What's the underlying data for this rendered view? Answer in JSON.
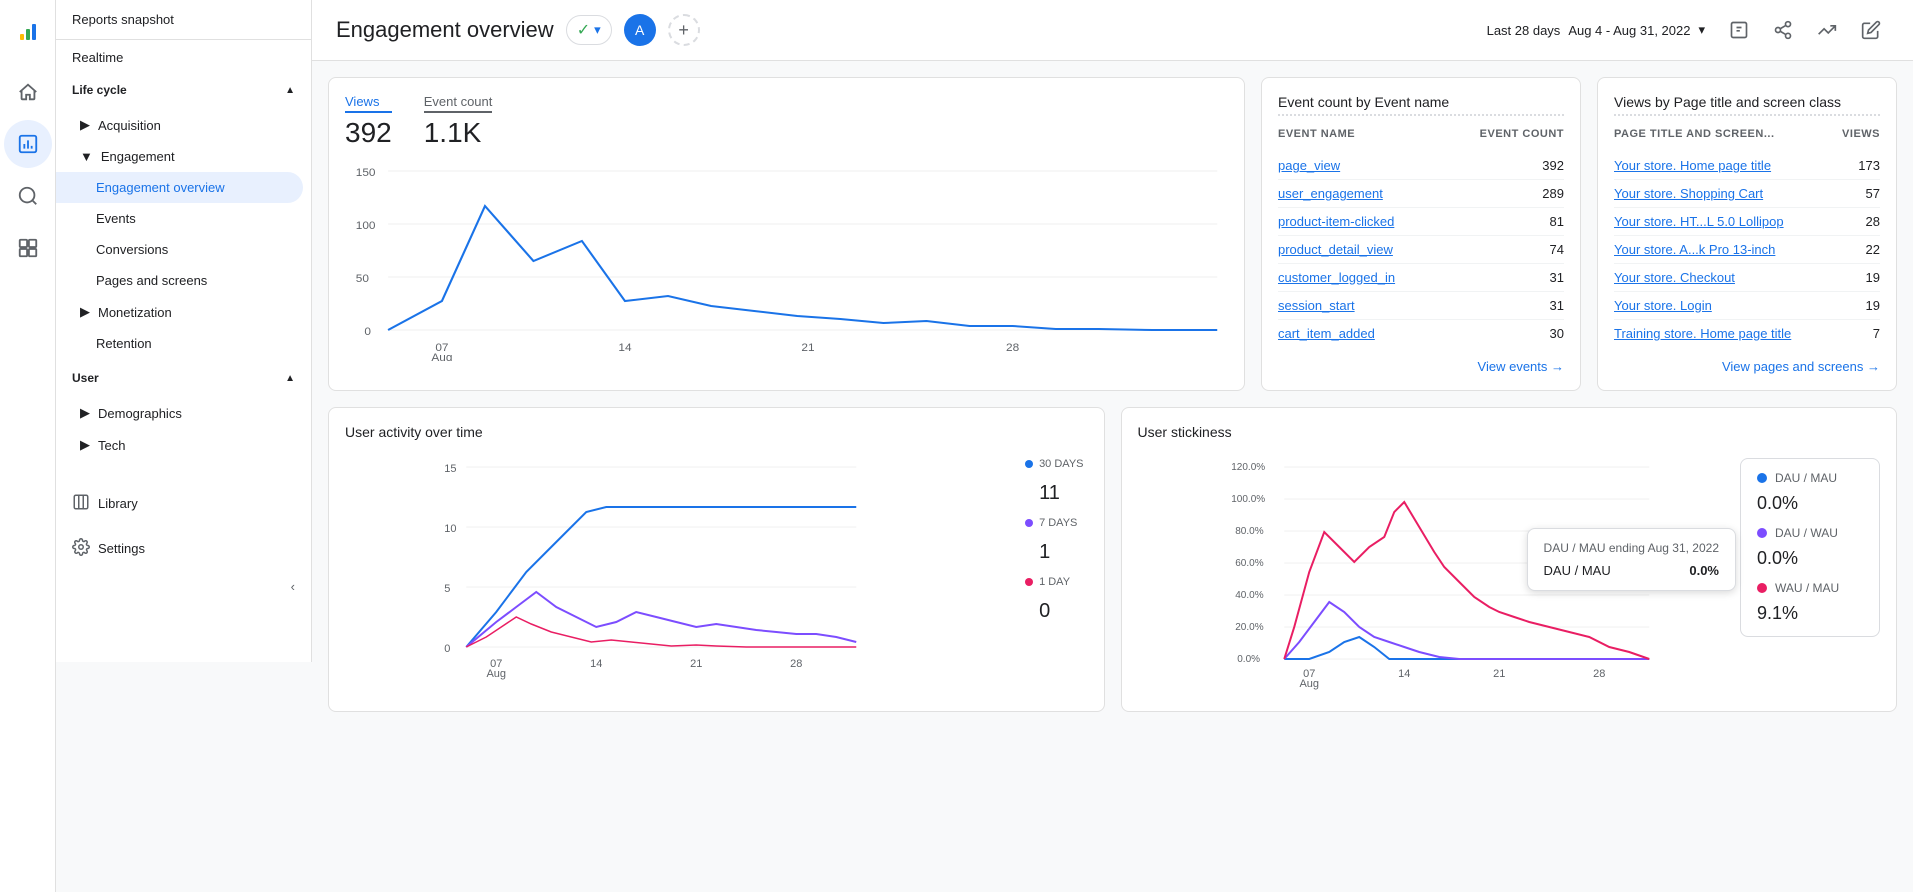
{
  "app": {
    "title": "Google Analytics"
  },
  "nav_icons": [
    {
      "name": "home-icon",
      "symbol": "⌂",
      "active": false
    },
    {
      "name": "analytics-icon",
      "symbol": "📊",
      "active": true
    },
    {
      "name": "notifications-icon",
      "symbol": "🔔",
      "active": false
    },
    {
      "name": "reports-icon",
      "symbol": "📋",
      "active": false
    }
  ],
  "sidebar": {
    "header": "Reports snapshot",
    "realtime": "Realtime",
    "lifecycle": {
      "label": "Life cycle",
      "items": [
        {
          "label": "Acquisition",
          "expanded": false,
          "active": false
        },
        {
          "label": "Engagement",
          "expanded": true,
          "active": false,
          "subitems": [
            {
              "label": "Engagement overview",
              "active": true
            },
            {
              "label": "Events",
              "active": false
            },
            {
              "label": "Conversions",
              "active": false
            },
            {
              "label": "Pages and screens",
              "active": false
            }
          ]
        },
        {
          "label": "Monetization",
          "expanded": false,
          "active": false
        },
        {
          "label": "Retention",
          "active": false
        }
      ]
    },
    "user": {
      "label": "User",
      "items": [
        {
          "label": "Demographics",
          "expanded": false
        },
        {
          "label": "Tech",
          "expanded": false
        }
      ]
    },
    "library": "Library",
    "settings": "Settings",
    "collapse": "‹"
  },
  "topbar": {
    "page_title": "Engagement overview",
    "status_label": "▾",
    "avatar": "A",
    "date_range_label": "Last 28 days",
    "date_range": "Aug 4 - Aug 31, 2022",
    "date_icon": "▾"
  },
  "main_chart": {
    "views_label": "Views",
    "views_value": "392",
    "event_count_label": "Event count",
    "event_count_value": "1.1K",
    "y_axis": [
      "150",
      "100",
      "50",
      "0"
    ],
    "x_axis": [
      "07\nAug",
      "14",
      "21",
      "28"
    ]
  },
  "event_count_card": {
    "title": "Event count by Event name",
    "col1": "EVENT NAME",
    "col2": "EVENT COUNT",
    "rows": [
      {
        "name": "page_view",
        "value": "392"
      },
      {
        "name": "user_engagement",
        "value": "289"
      },
      {
        "name": "product-item-clicked",
        "value": "81"
      },
      {
        "name": "product_detail_view",
        "value": "74"
      },
      {
        "name": "customer_logged_in",
        "value": "31"
      },
      {
        "name": "session_start",
        "value": "31"
      },
      {
        "name": "cart_item_added",
        "value": "30"
      }
    ],
    "view_link": "View events →"
  },
  "views_card": {
    "title": "Views by Page title and screen class",
    "col1": "PAGE TITLE AND SCREEN...",
    "col2": "VIEWS",
    "rows": [
      {
        "name": "Your store. Home page title",
        "value": "173"
      },
      {
        "name": "Your store. Shopping Cart",
        "value": "57"
      },
      {
        "name": "Your store. HT...L 5.0 Lollipop",
        "value": "28"
      },
      {
        "name": "Your store. A...k Pro 13-inch",
        "value": "22"
      },
      {
        "name": "Your store. Checkout",
        "value": "19"
      },
      {
        "name": "Your store. Login",
        "value": "19"
      },
      {
        "name": "Training store. Home page title",
        "value": "7"
      }
    ],
    "view_link": "View pages and screens →"
  },
  "activity_card": {
    "title": "User activity over time",
    "legend": [
      {
        "label": "30 DAYS",
        "value": "11",
        "color": "#1a73e8"
      },
      {
        "label": "7 DAYS",
        "value": "1",
        "color": "#7c4dff"
      },
      {
        "label": "1 DAY",
        "value": "0",
        "color": "#e91e63"
      }
    ],
    "y_axis": [
      "15",
      "10",
      "5",
      "0"
    ],
    "x_axis": [
      "07\nAug",
      "14",
      "21",
      "28"
    ]
  },
  "stickiness_card": {
    "title": "User stickiness",
    "y_axis": [
      "120.0%",
      "100.0%",
      "80.0%",
      "60.0%",
      "40.0%",
      "20.0%",
      "0.0%"
    ],
    "x_axis": [
      "07\nAug",
      "14",
      "21",
      "28"
    ],
    "legend": [
      {
        "label": "DAU / MAU",
        "value": "0.0%",
        "color": "#1a73e8"
      },
      {
        "label": "DAU / WAU",
        "value": "0.0%",
        "color": "#7c4dff"
      },
      {
        "label": "WAU / MAU",
        "value": "9.1%",
        "color": "#e91e63"
      }
    ],
    "tooltip": {
      "title": "DAU / MAU ending Aug 31, 2022",
      "row_label": "DAU / MAU",
      "row_value": "0.0%"
    }
  }
}
